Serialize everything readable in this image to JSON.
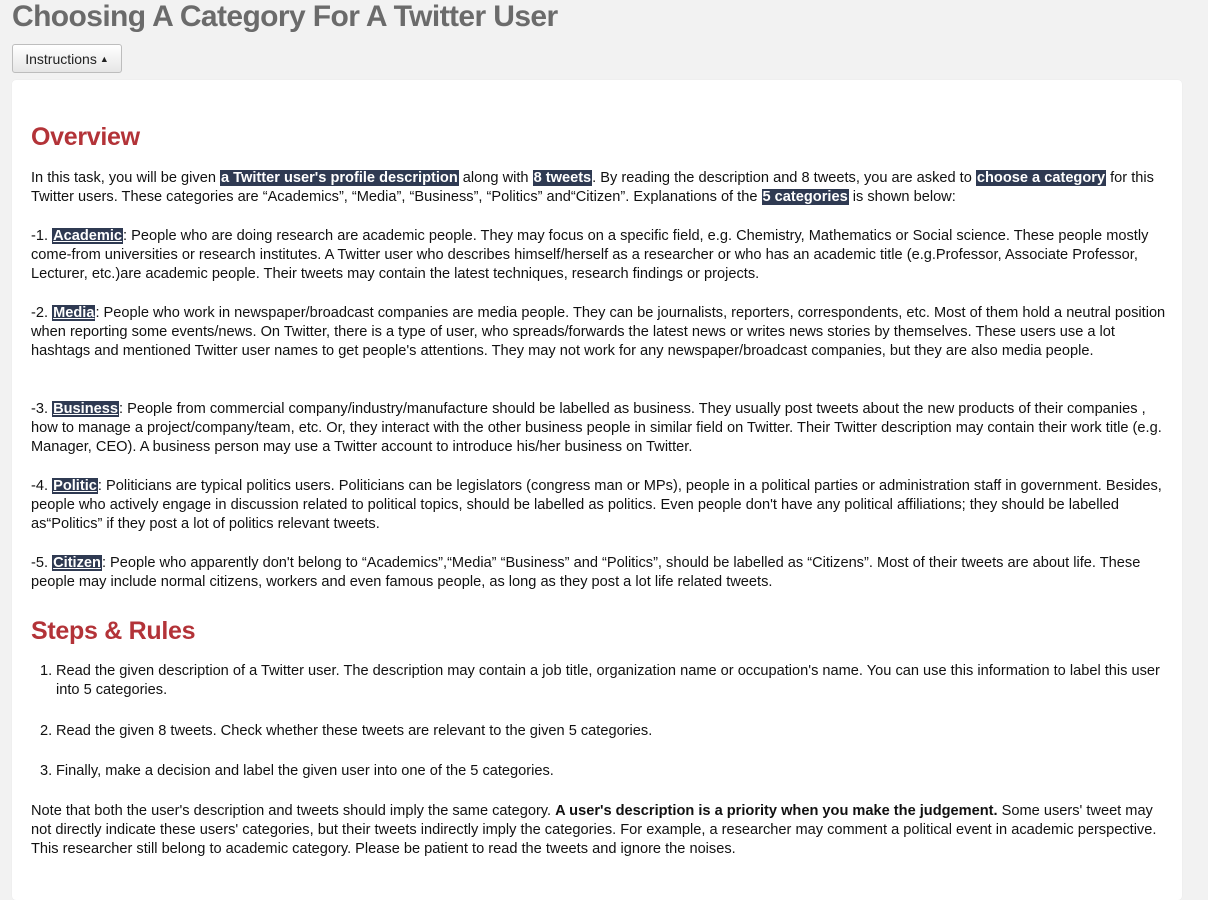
{
  "page": {
    "title": "Choosing A Category For A Twitter User",
    "instructions_button": "Instructions",
    "caret": "▲"
  },
  "overview": {
    "heading": "Overview",
    "intro": {
      "t1": "In this task, you will be given ",
      "h1": "a Twitter user's profile description",
      "t2": " along with ",
      "h2": "8 tweets",
      "t3": ". By reading the description and 8 tweets, you are asked to ",
      "h3": "choose a category",
      "t4": " for this Twitter users. These categories are “Academics”, “Media”, “Business”, “Politics” and“Citizen”. Explanations of the ",
      "h4": "5 categories",
      "t5": " is shown below:"
    },
    "categories": [
      {
        "prefix": "-1. ",
        "name": "Academic",
        "text": ": People who are doing research are academic people. They may focus on a specific field, e.g. Chemistry, Mathematics or Social science. These people mostly come-from universities or research institutes. A Twitter user who describes himself/herself as a researcher or who has an academic title (e.g.Professor, Associate Professor, Lecturer, etc.)are academic people. Their tweets may contain the latest techniques, research findings or projects."
      },
      {
        "prefix": "-2. ",
        "name": "Media",
        "text": ": People who work in newspaper/broadcast companies are media people. They can be journalists, reporters, correspondents, etc. Most of them hold a neutral position when reporting some events/news. On Twitter, there is a type of user, who spreads/forwards the latest news or writes news stories by themselves. These users use a lot hashtags and mentioned Twitter user names to get people's attentions. They may not work for any newspaper/broadcast companies, but they are also media people."
      },
      {
        "prefix": "-3. ",
        "name": "Business",
        "text": ": People from commercial company/industry/manufacture should be labelled as business. They usually post tweets about the new products of their companies , how to manage a project/company/team, etc. Or, they interact with the other business people in similar field on Twitter. Their Twitter description may contain their work title (e.g. Manager, CEO). A business person may use a Twitter account to introduce his/her business on Twitter."
      },
      {
        "prefix": "-4. ",
        "name": "Politic",
        "text": ": Politicians are typical politics users. Politicians can be legislators (congress man or MPs), people in a political parties or administration staff in government. Besides, people who actively engage in discussion related to political topics, should be labelled as politics. Even people don't have any political affiliations; they should be labelled as“Politics” if they post a lot of politics relevant tweets."
      },
      {
        "prefix": "-5. ",
        "name": "Citizen",
        "text": ": People who apparently don't belong to “Academics”,“Media” “Business” and “Politics”, should be labelled as  “Citizens”. Most of their tweets are about life. These people may include normal citizens, workers and even famous people, as long as they post a lot life related tweets."
      }
    ]
  },
  "steps": {
    "heading": "Steps & Rules",
    "items": [
      {
        "num": "1.",
        "text": "Read the given description of a Twitter user. The description may contain a job title, organization name or occupation's name. You can use this information to label this user into 5 categories."
      },
      {
        "num": "2.",
        "text": "Read the given 8 tweets. Check whether these tweets are relevant to the given 5 categories."
      },
      {
        "num": "3.",
        "text": "Finally, make a decision and label the given user into one of the 5 categories."
      }
    ],
    "note": {
      "t1": "Note that both the user's description and tweets should imply the same category. ",
      "bold": "A user's description is a priority when you make the judgement.",
      "t2": "  Some users' tweet may not directly indicate these users' categories, but their tweets indirectly imply the categories.  For example, a researcher may comment a political event in academic perspective. This researcher still belong to academic category. Please be patient to read the tweets and ignore the noises."
    }
  }
}
